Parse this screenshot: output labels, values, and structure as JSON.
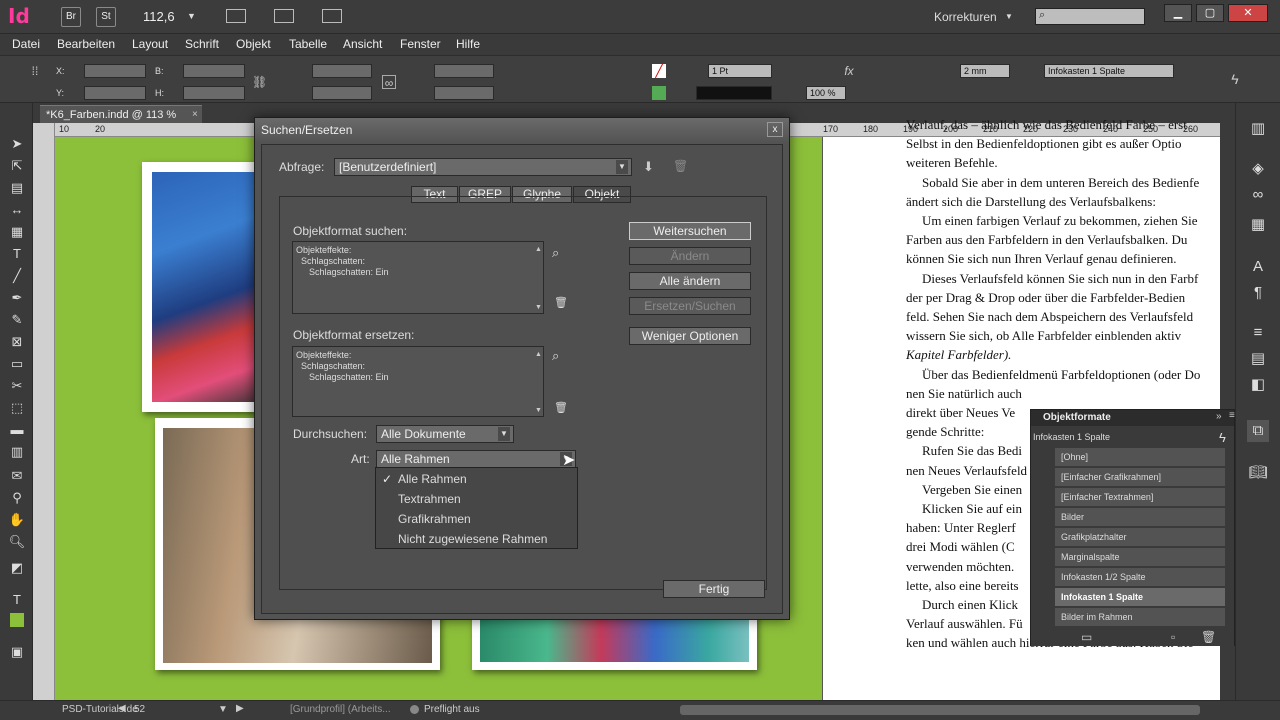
{
  "app": {
    "logo": "Id",
    "bridge_label": "Br",
    "stock_label": "St",
    "zoom_value": "112,6",
    "workspace": "Korrekturen"
  },
  "menu": [
    "Datei",
    "Bearbeiten",
    "Layout",
    "Schrift",
    "Objekt",
    "Tabelle",
    "Ansicht",
    "Fenster",
    "Hilfe"
  ],
  "control": {
    "x_label": "X:",
    "y_label": "Y:",
    "b_label": "B:",
    "h_label": "H:",
    "stroke_weight": "1 Pt",
    "stroke_mm": "2 mm",
    "opacity": "100 %",
    "style": "Infokasten 1 Spalte"
  },
  "document": {
    "tab_title": "*K6_Farben.indd @ 113 %"
  },
  "ruler": [
    "10",
    "20",
    "170",
    "180",
    "190",
    "200",
    "210",
    "220",
    "230",
    "240",
    "250",
    "260"
  ],
  "body_text": [
    "Verlauf, das – ähnlich wie das Bedienfeld Farbe – erst",
    "Selbst in den Bedienfeldoptionen gibt es außer Optio",
    "weiteren Befehle.",
    "Sobald Sie aber in dem unteren Bereich des Bedienfe",
    "ändert sich die Darstellung des Verlaufsbalkens:",
    "Um einen farbigen Verlauf zu bekommen, ziehen Sie",
    "Farben aus den Farbfeldern in den Verlaufsbalken. Du",
    "können Sie sich nun Ihren Verlauf genau definieren.",
    "Dieses Verlaufsfeld können Sie sich nun in den Farbf",
    "der per Drag & Drop oder über die Farbfelder-Bedien",
    "feld. Sehen Sie nach dem Abspeichern des Verlaufsfeld",
    "wissern Sie sich, ob Alle Farbfelder einblenden aktiv",
    "Kapitel Farbfelder).",
    "Über das Bedienfeldmenü Farbfeldoptionen (oder Do",
    "nen Sie natürlich auch",
    "direkt über Neues Ve",
    "gende Schritte:",
    "Rufen Sie das Bedi",
    "nen Neues Verlaufsfeld",
    "Vergeben Sie einen",
    "Klicken Sie auf ein",
    "haben: Unter Reglerf",
    "drei Modi wählen (C",
    "verwenden möchten.",
    "lette, also eine bereits",
    "Durch einen Klick",
    "Verlauf auswählen. Fü",
    "ken und wählen auch hierfür eine Farbe aus. Haben Sie"
  ],
  "dialog": {
    "title": "Suchen/Ersetzen",
    "close": "x",
    "query_label": "Abfrage:",
    "query_value": "[Benutzerdefiniert]",
    "tabs": [
      "Text",
      "GREP",
      "Glyphe",
      "Objekt"
    ],
    "find_label": "Objektformat suchen:",
    "find_lines": [
      "Objekteffekte:",
      "Schlagschatten:",
      "Schlagschatten: Ein"
    ],
    "replace_label": "Objektformat ersetzen:",
    "replace_lines": [
      "Objekteffekte:",
      "Schlagschatten:",
      "Schlagschatten: Ein"
    ],
    "search_label": "Durchsuchen:",
    "search_value": "Alle Dokumente",
    "type_label": "Art:",
    "type_value": "Alle Rahmen",
    "type_options": [
      "Alle Rahmen",
      "Textrahmen",
      "Grafikrahmen",
      "Nicht zugewiesene Rahmen"
    ],
    "buttons": {
      "find_next": "Weitersuchen",
      "change": "Ändern",
      "change_all": "Alle ändern",
      "change_find": "Ersetzen/Suchen",
      "fewer_options": "Weniger Optionen",
      "done": "Fertig"
    }
  },
  "objpanel": {
    "title": "Objektformate",
    "current": "Infokasten 1 Spalte",
    "items": [
      "[Ohne]",
      "[Einfacher Grafikrahmen]",
      "[Einfacher Textrahmen]",
      "Bilder",
      "Grafikplatzhalter",
      "Marginalspalte",
      "Infokasten 1/2 Spalte",
      "Infokasten 1 Spalte",
      "Bilder im Rahmen"
    ],
    "selected_index": 7
  },
  "status": {
    "page": "52",
    "profile": "[Grundprofil] (Arbeits...",
    "preflight": "Preflight aus",
    "watermark": "PSD-Tutorials.de"
  }
}
